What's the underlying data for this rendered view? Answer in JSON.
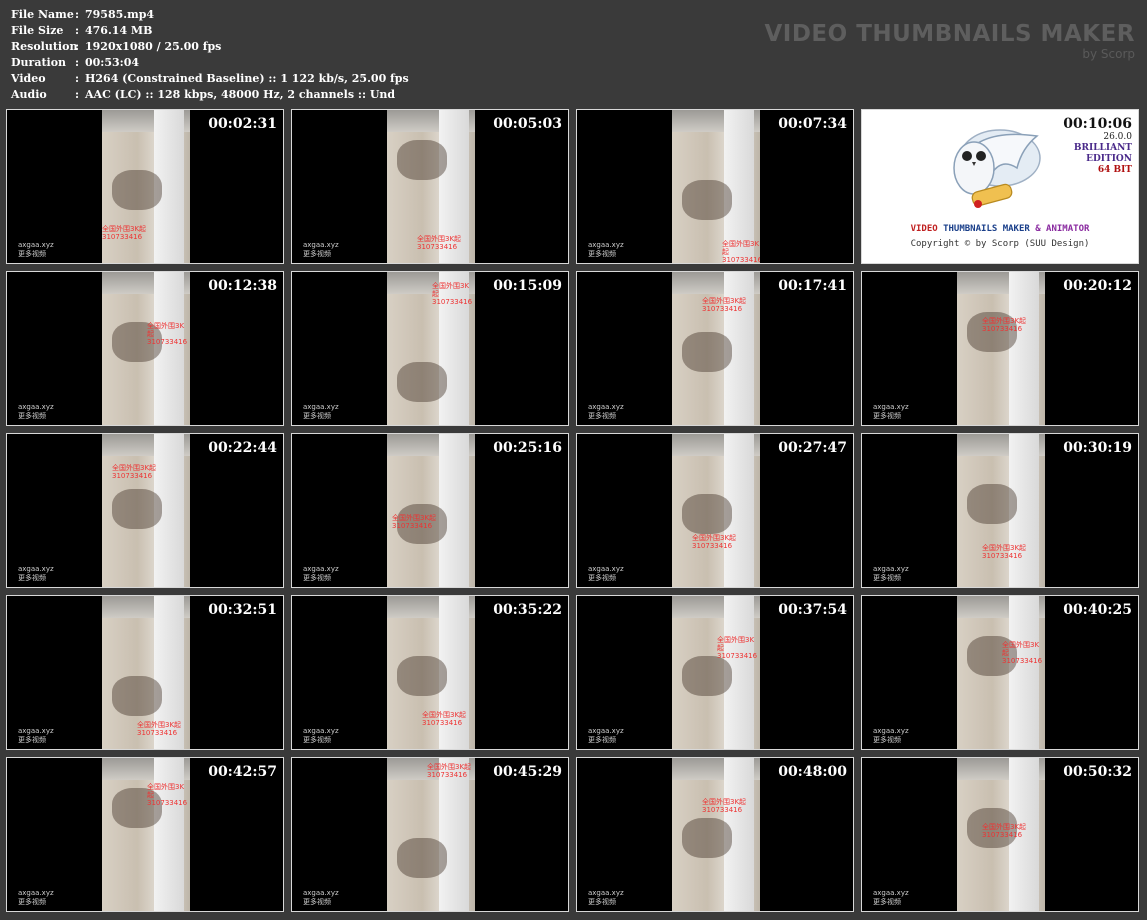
{
  "info": [
    {
      "label": "File Name",
      "value": "79585.mp4"
    },
    {
      "label": "File Size",
      "value": "476.14 MB"
    },
    {
      "label": "Resolution",
      "value": "1920x1080 / 25.00 fps"
    },
    {
      "label": "Duration",
      "value": "00:53:04"
    },
    {
      "label": "Video",
      "value": "H264 (Constrained Baseline) :: 1 122 kb/s, 25.00 fps"
    },
    {
      "label": "Audio",
      "value": "AAC (LC) :: 128 kbps, 48000 Hz, 2 channels :: Und"
    }
  ],
  "brand": {
    "title": "VIDEO THUMBNAILS MAKER",
    "sub": "by Scorp"
  },
  "watermark": {
    "line1": "axgaa.xyz",
    "line2": "更多视频"
  },
  "red_watermark": {
    "line1": "全国外围3K起",
    "line2": "310733416"
  },
  "logo": {
    "version": "26.0.0",
    "edition1": "BRILLIANT",
    "edition2": "EDITION",
    "bits": "64 BIT",
    "title_part1": "VIDEO",
    "title_part2": "THUMBNAILS MAKER",
    "title_part3": "& ANIMATOR",
    "copyright": "Copyright © by Scorp (SUU Design)"
  },
  "thumbnails": [
    {
      "time": "00:02:31",
      "kind": "frame"
    },
    {
      "time": "00:05:03",
      "kind": "frame"
    },
    {
      "time": "00:07:34",
      "kind": "frame"
    },
    {
      "time": "00:10:06",
      "kind": "logo"
    },
    {
      "time": "00:12:38",
      "kind": "frame"
    },
    {
      "time": "00:15:09",
      "kind": "frame"
    },
    {
      "time": "00:17:41",
      "kind": "frame"
    },
    {
      "time": "00:20:12",
      "kind": "frame"
    },
    {
      "time": "00:22:44",
      "kind": "frame"
    },
    {
      "time": "00:25:16",
      "kind": "frame"
    },
    {
      "time": "00:27:47",
      "kind": "frame"
    },
    {
      "time": "00:30:19",
      "kind": "frame"
    },
    {
      "time": "00:32:51",
      "kind": "frame"
    },
    {
      "time": "00:35:22",
      "kind": "frame"
    },
    {
      "time": "00:37:54",
      "kind": "frame"
    },
    {
      "time": "00:40:25",
      "kind": "frame"
    },
    {
      "time": "00:42:57",
      "kind": "frame"
    },
    {
      "time": "00:45:29",
      "kind": "frame"
    },
    {
      "time": "00:48:00",
      "kind": "frame"
    },
    {
      "time": "00:50:32",
      "kind": "frame"
    }
  ]
}
